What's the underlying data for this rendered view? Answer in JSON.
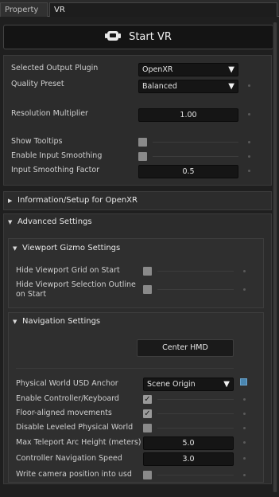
{
  "tabs": [
    {
      "label": "Property",
      "active": false
    },
    {
      "label": "VR",
      "active": true
    }
  ],
  "start_vr": {
    "label": "Start VR",
    "icon": "vr-headset-icon"
  },
  "general": {
    "output_plugin_label": "Selected Output Plugin",
    "output_plugin_value": "OpenXR",
    "quality_preset_label": "Quality Preset",
    "quality_preset_value": "Balanced",
    "resolution_label": "Resolution Multiplier",
    "resolution_value": "1.00",
    "show_tooltips_label": "Show Tooltips",
    "show_tooltips_checked": false,
    "input_smoothing_label": "Enable Input Smoothing",
    "input_smoothing_checked": false,
    "smoothing_factor_label": "Input Smoothing Factor",
    "smoothing_factor_value": "0.5"
  },
  "info_section": {
    "label": "Information/Setup for OpenXR",
    "expanded": false
  },
  "advanced": {
    "label": "Advanced Settings",
    "expanded": true,
    "gizmo": {
      "label": "Viewport Gizmo Settings",
      "hide_grid_label": "Hide Viewport Grid on Start",
      "hide_grid_checked": false,
      "hide_selection_label_1": "Hide Viewport Selection Outline",
      "hide_selection_label_2": "on Start",
      "hide_selection_checked": false
    },
    "navigation": {
      "label": "Navigation Settings",
      "center_hmd_label": "Center HMD",
      "anchor_label": "Physical World USD Anchor",
      "anchor_value": "Scene Origin",
      "controller_keyboard_label": "Enable Controller/Keyboard",
      "controller_keyboard_checked": true,
      "floor_aligned_label": "Floor-aligned movements",
      "floor_aligned_checked": true,
      "disable_leveled_label": "Disable Leveled Physical World",
      "disable_leveled_checked": false,
      "teleport_arc_label": "Max Teleport Arc Height (meters)",
      "teleport_arc_value": "5.0",
      "nav_speed_label": "Controller Navigation Speed",
      "nav_speed_value": "3.0",
      "write_camera_label": "Write camera position into usd",
      "write_camera_checked": false
    }
  },
  "colors": {
    "accent_blue": "#4a86b0",
    "field_bg": "#151515",
    "panel_bg": "#2c2c2c"
  }
}
